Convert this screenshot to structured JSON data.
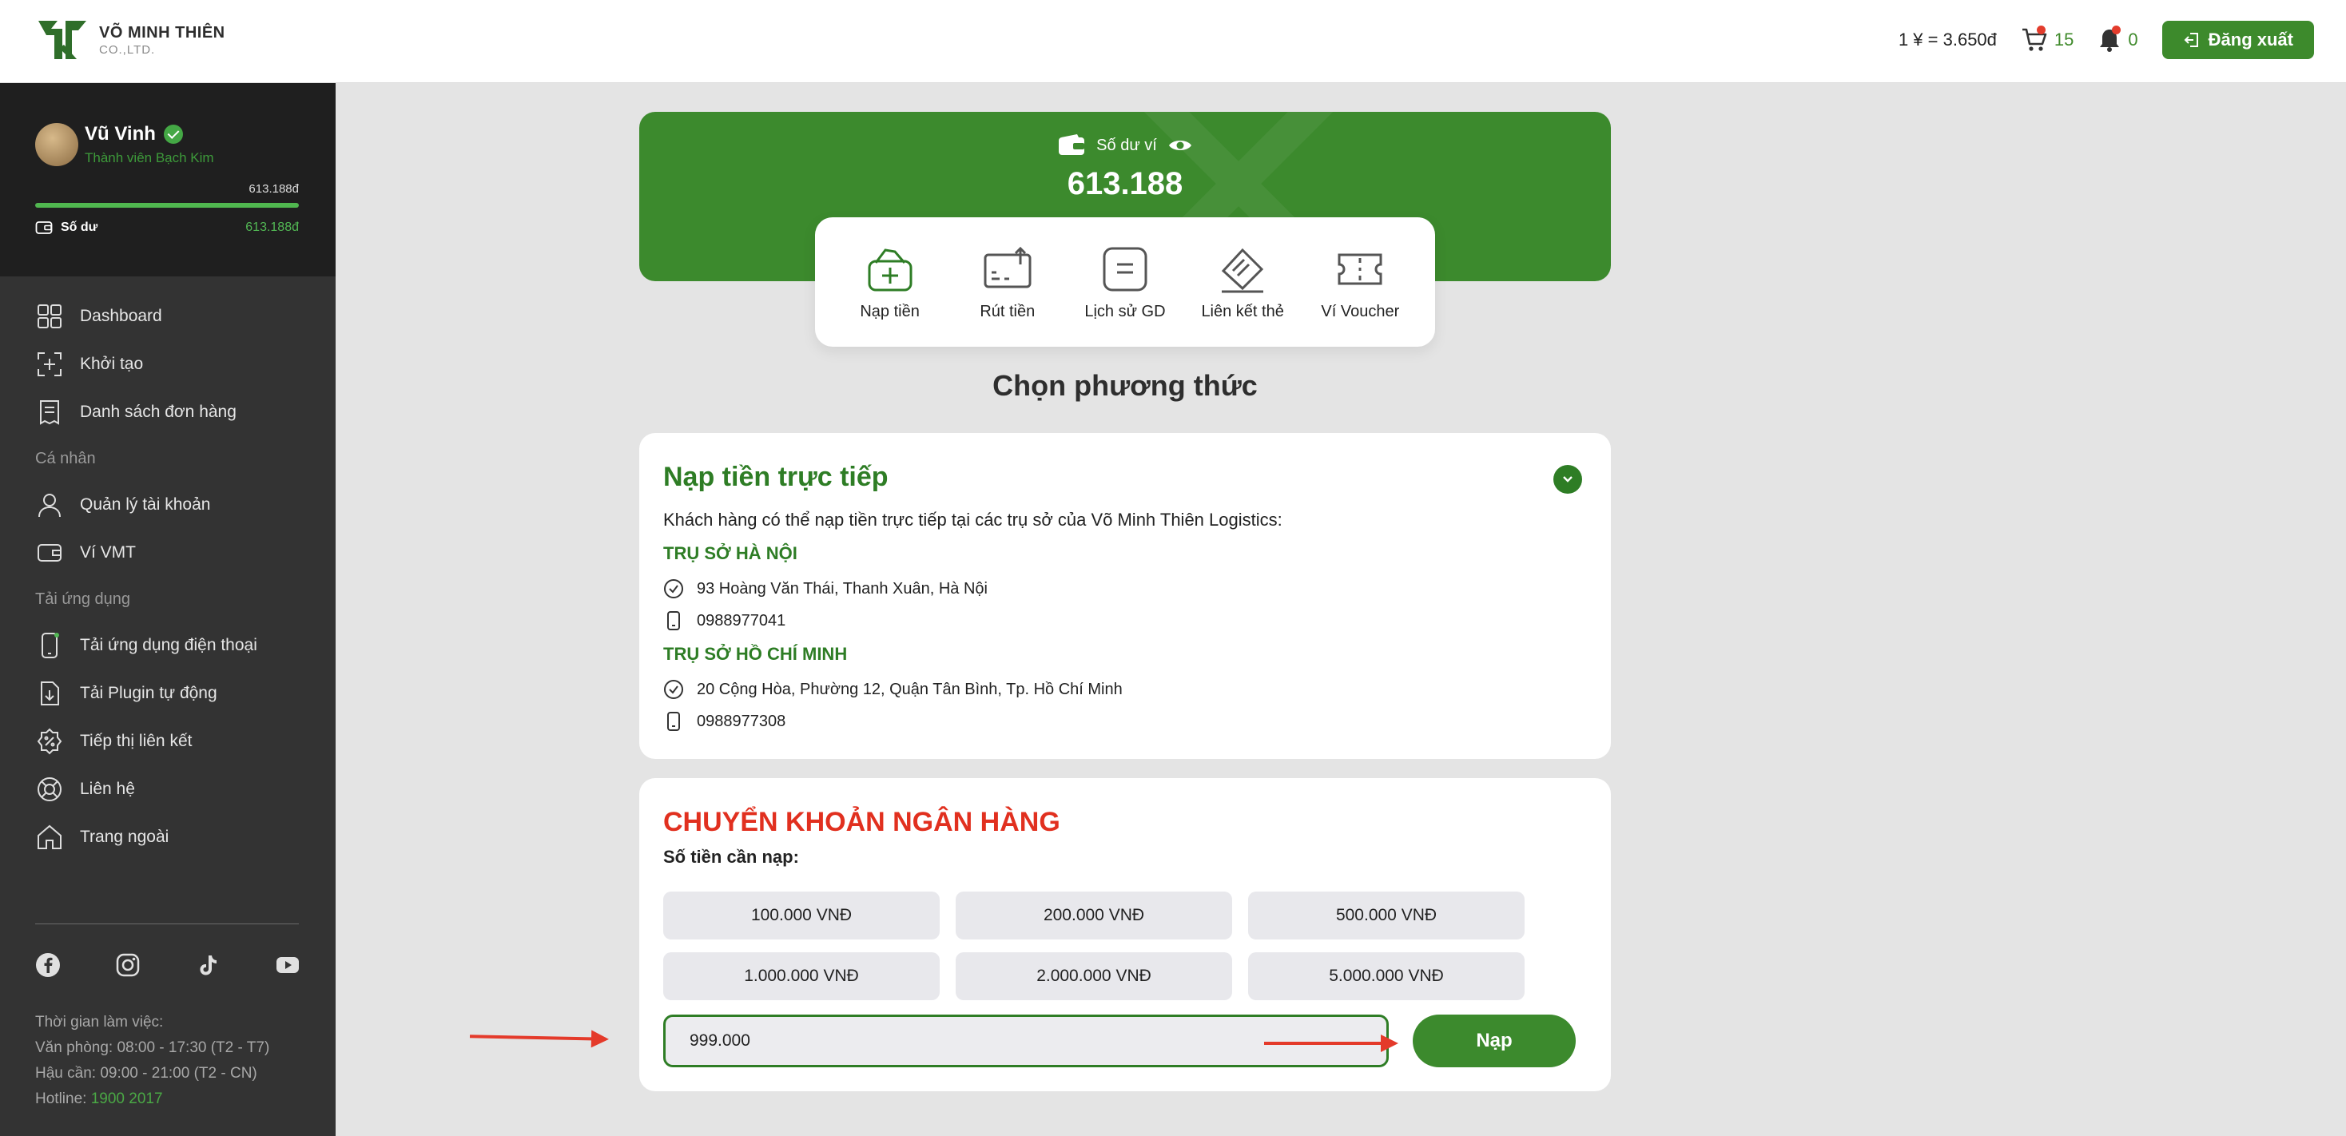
{
  "header": {
    "logo_name": "VÕ MINH THIÊN",
    "logo_sub": "CO.,LTD.",
    "exchange_rate": "1 ¥ = 3.650đ",
    "cart_count": "15",
    "notification_count": "0",
    "logout_label": "Đăng xuất"
  },
  "sidebar": {
    "user_name": "Vũ Vinh",
    "user_rank": "Thành viên Bạch Kim",
    "balance_top": "613.188đ",
    "balance_progress": 1.0,
    "balance_label": "Số dư",
    "balance_value": "613.188đ",
    "nav": {
      "dashboard": "Dashboard",
      "create": "Khởi tạo",
      "orders": "Danh sách đơn hàng",
      "section_personal": "Cá nhân",
      "account": "Quản lý tài khoản",
      "wallet": "Ví VMT",
      "section_apps": "Tải ứng dụng",
      "mobile_app": "Tải ứng dụng điện thoại",
      "plugin": "Tải Plugin tự động",
      "affiliate": "Tiếp thị liên kết",
      "contact": "Liên hệ",
      "home": "Trang ngoài"
    },
    "work_hours": {
      "title": "Thời gian làm việc:",
      "office": "Văn phòng: 08:00 - 17:30 (T2 - T7)",
      "logistics": "Hậu cần: 09:00 - 21:00 (T2 - CN)",
      "hotline_label": "Hotline: ",
      "hotline_value": "1900 2017"
    }
  },
  "wallet": {
    "title": "Số dư ví",
    "amount": "613.188"
  },
  "actions": {
    "deposit": "Nạp tiền",
    "withdraw": "Rút tiền",
    "history": "Lịch sử GD",
    "link_card": "Liên kết thẻ",
    "voucher": "Ví Voucher"
  },
  "section_title": "Chọn phương thức",
  "direct": {
    "title": "Nạp tiền trực tiếp",
    "description": "Khách hàng có thể nạp tiền trực tiếp tại các trụ sở của Võ Minh Thiên Logistics:",
    "hanoi_title": "TRỤ SỞ HÀ NỘI",
    "hanoi_address": "93 Hoàng Văn Thái, Thanh Xuân, Hà Nội",
    "hanoi_phone": "0988977041",
    "hcm_title": "TRỤ SỞ HỒ CHÍ MINH",
    "hcm_address": "20 Cộng Hòa, Phường 12, Quận Tân Bình, Tp. Hồ Chí Minh",
    "hcm_phone": "0988977308"
  },
  "bank": {
    "title": "CHUYỂN KHOẢN NGÂN HÀNG",
    "amount_label": "Số tiền cần nạp:",
    "amounts": [
      "100.000 VNĐ",
      "200.000 VNĐ",
      "500.000 VNĐ",
      "1.000.000 VNĐ",
      "2.000.000 VNĐ",
      "5.000.000 VNĐ"
    ],
    "input_value": "999.000",
    "submit_label": "Nạp"
  },
  "colors": {
    "brand_green": "#3c8a2d",
    "dark_green": "#2e7d25",
    "accent_red": "#e1301f",
    "sidebar_bg": "#333333"
  }
}
